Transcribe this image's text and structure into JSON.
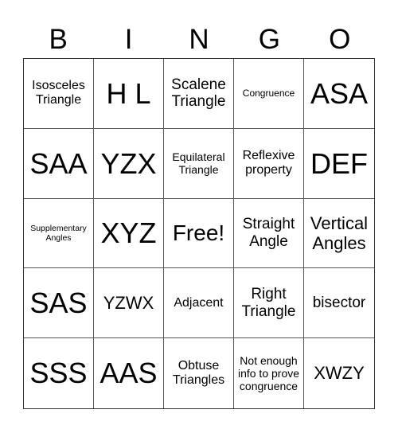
{
  "header": {
    "letters": [
      "B",
      "I",
      "N",
      "G",
      "O"
    ]
  },
  "cells": [
    {
      "text": "Isosceles Triangle",
      "size": "s-sm"
    },
    {
      "text": "H L",
      "size": "s-xl"
    },
    {
      "text": "Scalene Triangle",
      "size": "s-md"
    },
    {
      "text": "Congruence",
      "size": "s-xxs"
    },
    {
      "text": "ASA",
      "size": "s-xl"
    },
    {
      "text": "SAA",
      "size": "s-xl"
    },
    {
      "text": "YZX",
      "size": "s-xl"
    },
    {
      "text": "Equilateral Triangle",
      "size": "s-xs"
    },
    {
      "text": "Reflexive property",
      "size": "s-sm"
    },
    {
      "text": "DEF",
      "size": "s-xl"
    },
    {
      "text": "Supplementary Angles",
      "size": "s-tiny"
    },
    {
      "text": "XYZ",
      "size": "s-xl"
    },
    {
      "text": "Free!",
      "size": "s-lg"
    },
    {
      "text": "Straight Angle",
      "size": "s-md"
    },
    {
      "text": "Vertical Angles",
      "size": "s-ml"
    },
    {
      "text": "SAS",
      "size": "s-xl"
    },
    {
      "text": "YZWX",
      "size": "s-ml"
    },
    {
      "text": "Adjacent",
      "size": "s-sm"
    },
    {
      "text": "Right Triangle",
      "size": "s-md"
    },
    {
      "text": "bisector",
      "size": "s-md"
    },
    {
      "text": "SSS",
      "size": "s-xl"
    },
    {
      "text": "AAS",
      "size": "s-xl"
    },
    {
      "text": "Obtuse Triangles",
      "size": "s-sm"
    },
    {
      "text": "Not enough info to prove congruence",
      "size": "s-xs"
    },
    {
      "text": "XWZY",
      "size": "s-ml"
    }
  ]
}
